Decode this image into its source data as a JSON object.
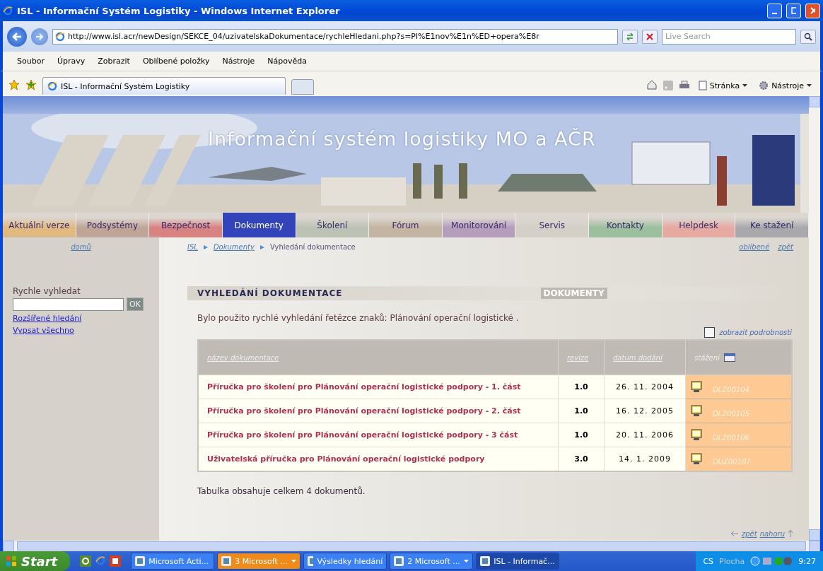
{
  "window": {
    "title": "ISL - Informační Systém Logistiky - Windows Internet Explorer"
  },
  "browser": {
    "address": "http://www.isl.acr/newDesign/SEKCE_04/uzivatelskaDokumentace/rychleHledani.php?s=Pl%E1nov%E1n%ED+opera%E8r",
    "search_placeholder": "Live Search",
    "menu": [
      "Soubor",
      "Úpravy",
      "Zobrazit",
      "Oblíbené položky",
      "Nástroje",
      "Nápověda"
    ],
    "tab": "ISL - Informační Systém Logistiky",
    "toolbar": [
      "Stránka",
      "Nástroje"
    ]
  },
  "page": {
    "banner_title": "Informační systém logistiky MO a AČR",
    "nav": [
      {
        "label": "Aktuální verze",
        "color": "#e2b97e",
        "selected": false
      },
      {
        "label": "Podsystémy",
        "color": "#bfa596",
        "selected": false
      },
      {
        "label": "Bezpečnost",
        "color": "#d98282",
        "selected": false
      },
      {
        "label": "Dokumenty",
        "color": "#3344bb",
        "selected": true
      },
      {
        "label": "Školení",
        "color": "#bcc2b4",
        "selected": false
      },
      {
        "label": "Fórum",
        "color": "#c4b4a2",
        "selected": false
      },
      {
        "label": "Monitorování",
        "color": "#b49ebb",
        "selected": false
      },
      {
        "label": "Servis",
        "color": "#d4d0c8",
        "selected": false
      },
      {
        "label": "Kontakty",
        "color": "#9cbf9e",
        "selected": false
      },
      {
        "label": "Helpdesk",
        "color": "#e6aaa2",
        "selected": false
      },
      {
        "label": "Ke stažení",
        "color": "#a9a9ad",
        "selected": false
      }
    ],
    "sidebar": {
      "home": "domů",
      "search_label": "Rychle vyhledat",
      "search_button": "OK",
      "links": [
        "Rozšířené hledání",
        "Vypsat všechno"
      ]
    },
    "breadcrumb": [
      {
        "label": "ISL",
        "link": true
      },
      {
        "label": "Dokumenty",
        "link": true
      },
      {
        "label": "Vyhledání dokumentace",
        "link": false
      }
    ],
    "top_links": [
      "oblíbené",
      "zpět"
    ],
    "section_title": "VYHLEDÁNÍ DOKUMENTACE",
    "section_tag": "DOKUMENTY",
    "message": "Bylo použito rychlé vyhledání řetězce znaků: Plánování operační logistické .",
    "details": {
      "label": "zobrazit podrobnosti",
      "checked": false
    },
    "table": {
      "columns": [
        "název dokumentace",
        "revize",
        "datum dodání",
        "stážení"
      ],
      "rows": [
        {
          "name": "Příručka pro školení pro Plánování operační logistické podpory - 1. část",
          "revision": "1.0",
          "date": "26. 11. 2004",
          "code": "DLZ00104"
        },
        {
          "name": "Příručka pro školení pro Plánování operační logistické podpory - 2. část",
          "revision": "1.0",
          "date": "16. 12. 2005",
          "code": "DLZ00105"
        },
        {
          "name": "Příručka pro školení pro Plánování operační logistické podpory - 3 část",
          "revision": "1.0",
          "date": "20. 11. 2006",
          "code": "DLZ00106"
        },
        {
          "name": "Uživatelská příručka pro Plánování operační logistické podpory",
          "revision": "3.0",
          "date": "14. 1. 2009",
          "code": "DUZ00107"
        }
      ]
    },
    "summary": "Tabulka obsahuje celkem 4 dokumentů.",
    "bottom_links": [
      "zpět",
      "nahoru"
    ]
  },
  "taskbar": {
    "start": "Start",
    "tasks": [
      {
        "label": "Microsoft Acti...",
        "kind": "single",
        "selected": false,
        "highlighted": false
      },
      {
        "label": "3 Microsoft ...",
        "kind": "group",
        "selected": false,
        "highlighted": true
      },
      {
        "label": "Výsledky hledání",
        "kind": "single",
        "selected": false,
        "highlighted": false
      },
      {
        "label": "2 Microsoft ...",
        "kind": "group",
        "selected": false,
        "highlighted": false
      },
      {
        "label": "ISL - Informač...",
        "kind": "single",
        "selected": true,
        "highlighted": false
      }
    ],
    "language": "CS",
    "desktop": "Plocha",
    "time": "9:27"
  }
}
